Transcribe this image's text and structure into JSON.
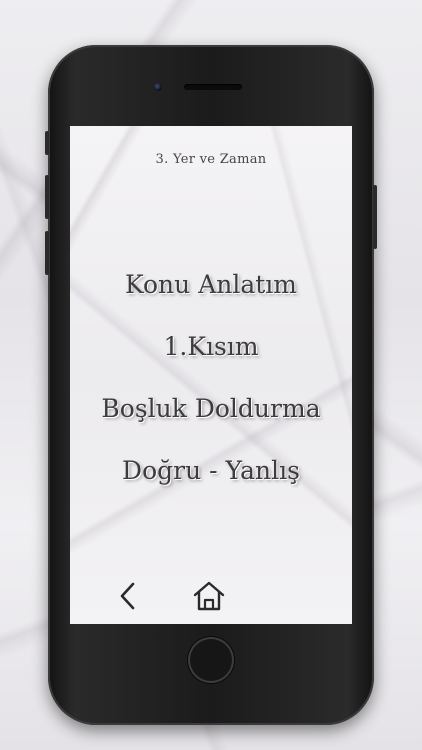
{
  "header": {
    "subtitle": "3. Yer ve Zaman"
  },
  "menu": {
    "items": [
      {
        "label": "Konu Anlatım"
      },
      {
        "label": "1.Kısım"
      },
      {
        "label": "Boşluk Doldurma"
      },
      {
        "label": "Doğru - Yanlış"
      }
    ]
  },
  "nav": {
    "back_icon": "chevron-left-icon",
    "home_icon": "home-icon"
  },
  "colors": {
    "phone_body": "#1b1b1b",
    "text": "#3e3a3d",
    "marble": "#eeedf0"
  }
}
